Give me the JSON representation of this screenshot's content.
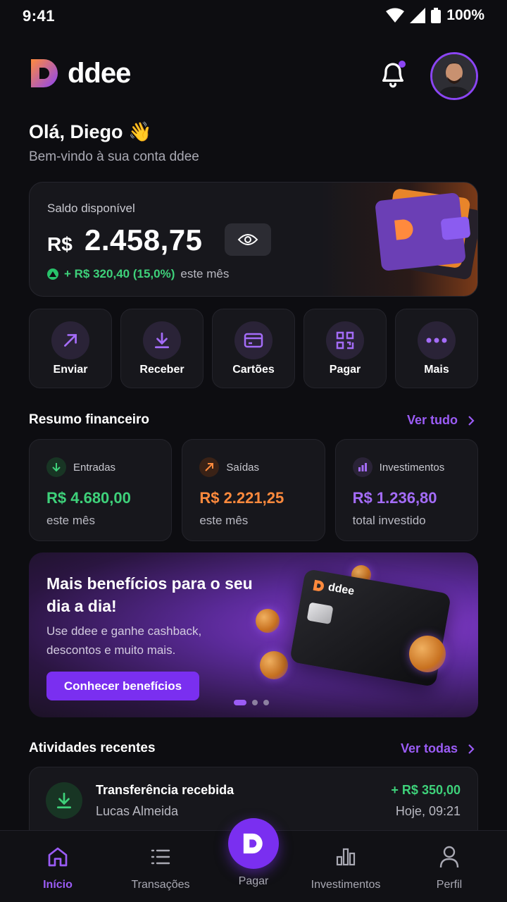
{
  "status": {
    "time": "9:41",
    "battery": "100%"
  },
  "brand": {
    "name": "ddee"
  },
  "greeting": {
    "title": "Olá, Diego 👋",
    "subtitle": "Bem-vindo à sua conta ddee"
  },
  "balance": {
    "label": "Saldo disponível",
    "currency": "R$",
    "value": "2.458,75",
    "change": "+ R$ 320,40 (15,0%)",
    "change_period": "este mês"
  },
  "actions": [
    {
      "label": "Enviar",
      "icon": "send-arrow-icon"
    },
    {
      "label": "Receber",
      "icon": "download-icon"
    },
    {
      "label": "Cartões",
      "icon": "card-icon"
    },
    {
      "label": "Pagar",
      "icon": "qr-code-icon"
    },
    {
      "label": "Mais",
      "icon": "more-dots-icon"
    }
  ],
  "summary": {
    "title": "Resumo financeiro",
    "see_all": "Ver tudo",
    "cards": [
      {
        "label": "Entradas",
        "value": "R$ 4.680,00",
        "sub": "este mês",
        "color": "#3ed17a"
      },
      {
        "label": "Saídas",
        "value": "R$ 2.221,25",
        "sub": "este mês",
        "color": "#ff8a3d"
      },
      {
        "label": "Investimentos",
        "value": "R$ 1.236,80",
        "sub": "total investido",
        "color": "#a46cf8"
      }
    ]
  },
  "promo": {
    "title": "Mais benefícios para o seu dia a dia!",
    "text": "Use ddee e ganhe cashback, descontos e muito mais.",
    "button": "Conhecer benefícios",
    "card_brand": "ddee"
  },
  "activities": {
    "title": "Atividades recentes",
    "see_all": "Ver todas",
    "items": [
      {
        "title": "Transferência recebida",
        "name": "Lucas Almeida",
        "amount": "+ R$ 350,00",
        "time": "Hoje, 09:21"
      }
    ]
  },
  "nav": {
    "items": [
      {
        "label": "Início",
        "icon": "home-icon",
        "active": true
      },
      {
        "label": "Transações",
        "icon": "list-icon"
      },
      {
        "label": "Pagar",
        "icon": "pay-logo-icon"
      },
      {
        "label": "Investimentos",
        "icon": "chart-icon"
      },
      {
        "label": "Perfil",
        "icon": "user-icon"
      }
    ]
  },
  "colors": {
    "accent": "#7a2ff0",
    "positive": "#3ed17a",
    "negative": "#ff8a3d",
    "background": "#0d0d11"
  }
}
